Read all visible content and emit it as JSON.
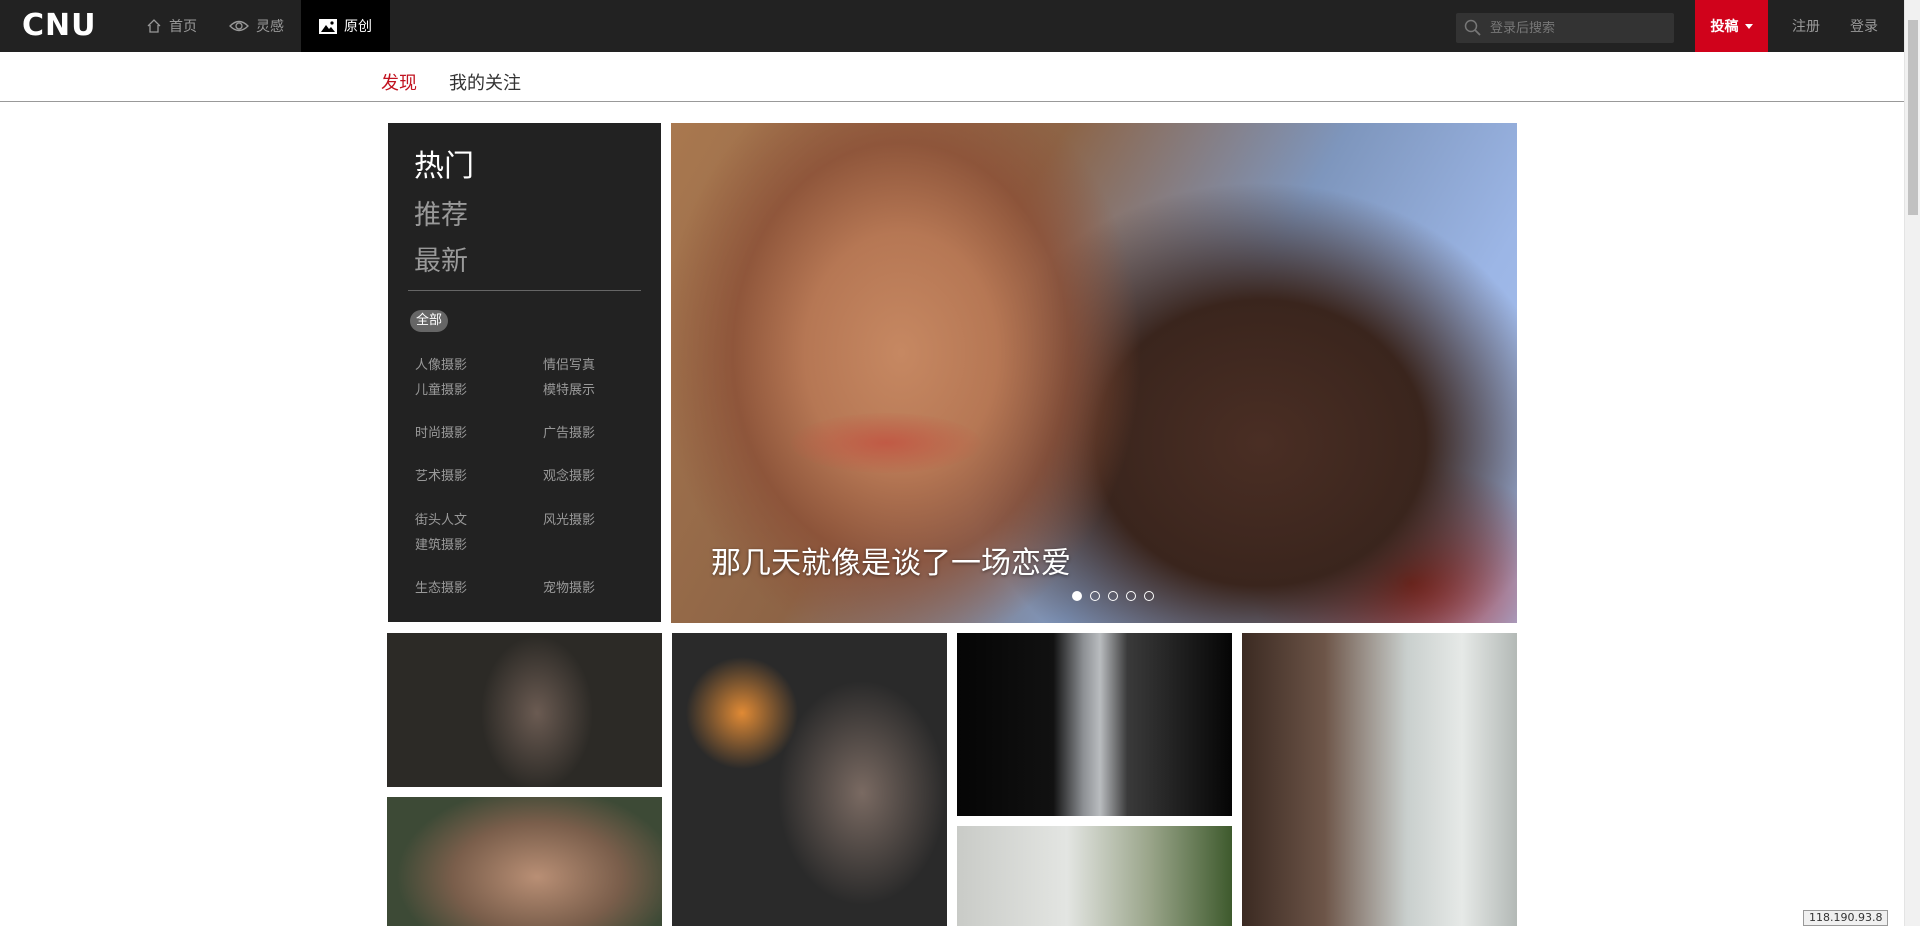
{
  "topbar": {
    "logo": "CNU",
    "nav": [
      {
        "label": "首页",
        "icon": "home-icon"
      },
      {
        "label": "灵感",
        "icon": "eye-icon"
      },
      {
        "label": "原创",
        "icon": "image-icon"
      }
    ],
    "search_placeholder": "登录后搜索",
    "submit_label": "投稿",
    "register_label": "注册",
    "login_label": "登录",
    "accent_color": "#d0021b"
  },
  "subtabs": {
    "discover": "发现",
    "following": "我的关注"
  },
  "panel": {
    "sorts": [
      "热门",
      "推荐",
      "最新"
    ],
    "all_label": "全部",
    "categories": [
      "人像摄影",
      "情侣写真",
      "儿童摄影",
      "模特展示",
      "时尚摄影",
      "广告摄影",
      "艺术摄影",
      "观念摄影",
      "街头人文",
      "风光摄影",
      "建筑摄影",
      "生态摄影",
      "宠物摄影"
    ]
  },
  "hero": {
    "caption": "那几天就像是谈了一场恋爱",
    "slide_count": 5,
    "active_slide": 1
  },
  "footer": {
    "ip": "118.190.93.8"
  }
}
